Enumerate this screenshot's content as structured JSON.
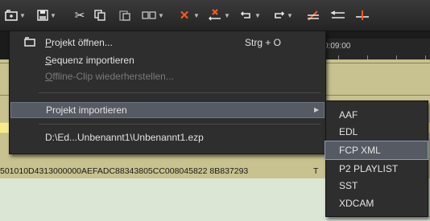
{
  "toolbar": {
    "buttons": [
      {
        "name": "open-project-icon",
        "glyph": "⎘",
        "dropdown": true
      },
      {
        "name": "save-icon",
        "glyph": "💾",
        "dropdown": true
      },
      {
        "name": "cut-icon",
        "glyph": "✂",
        "dropdown": false
      },
      {
        "name": "copy-icon",
        "glyph": "⧉",
        "dropdown": false
      },
      {
        "name": "paste-icon",
        "glyph": "📋",
        "dropdown": false
      },
      {
        "name": "replace-icon",
        "glyph": "▭",
        "dropdown": true
      },
      {
        "name": "delete-icon",
        "glyph": "✕",
        "dropdown": true
      },
      {
        "name": "ripple-delete-icon",
        "glyph": "✕",
        "dropdown": true
      },
      {
        "name": "undo-icon",
        "glyph": "↶",
        "dropdown": true
      },
      {
        "name": "redo-icon",
        "glyph": "↷",
        "dropdown": true
      },
      {
        "name": "marker-icon",
        "glyph": "✎",
        "dropdown": false
      },
      {
        "name": "trim-icon",
        "glyph": "⇤",
        "dropdown": false
      }
    ]
  },
  "menu": {
    "open_project": {
      "label": "Projekt öffnen...",
      "shortcut": "Strg + O",
      "accel_index": 0
    },
    "import_sequence": {
      "label": "Sequenz importieren",
      "accel_index": 0
    },
    "restore_offline": {
      "label": "Offline-Clip wiederherstellen...",
      "accel_index": 0,
      "disabled": true
    },
    "import_project": {
      "label": "Projekt importieren",
      "submenu": true
    },
    "recent_file": {
      "label": "D:\\Ed...Unbenannt1\\Unbenannt1.ezp"
    }
  },
  "submenu": {
    "items": [
      {
        "label": "AAF"
      },
      {
        "label": "EDL"
      },
      {
        "label": "FCP XML",
        "highlighted": true
      },
      {
        "label": "P2 PLAYLIST"
      },
      {
        "label": "SST"
      },
      {
        "label": "XDCAM"
      }
    ]
  },
  "timeline": {
    "ruler_time": "0:09:00",
    "clip_id": "501010D4313000000AEFADC88343805CC008045822 8B837293",
    "clip_suffix": "T"
  },
  "colors": {
    "menu_bg": "#2e2e2e",
    "highlight_bg": "#555a63",
    "delete_accent": "#ff5a1e",
    "timeline_track": "#c7c28f",
    "yellow_strip": "#f6eb8c"
  }
}
